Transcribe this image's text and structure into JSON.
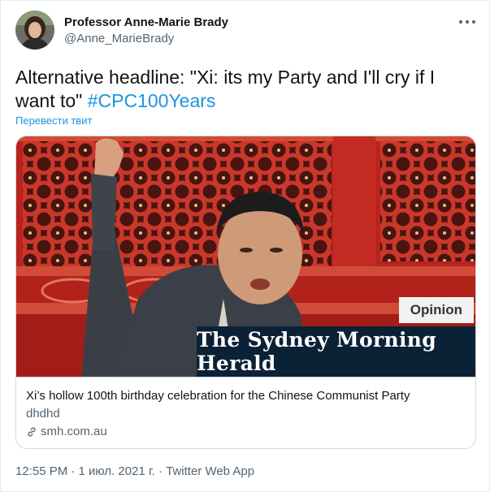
{
  "author": {
    "name": "Professor Anne-Marie Brady",
    "handle": "@Anne_MarieBrady"
  },
  "tweet": {
    "text": "Alternative headline: \"Xi: its my Party and I'll cry if I want to\" ",
    "hashtag": "#CPC100Years",
    "translate_label": "Перевести твит"
  },
  "card": {
    "badge": "Opinion",
    "publication": "The Sydney Morning Herald",
    "title": "Xi’s hollow 100th birthday celebration for the Chinese Communist Party",
    "description": "dhdhd",
    "domain": "smh.com.au"
  },
  "meta": {
    "timestamp": "12:55 PM · 1 июл. 2021 г. · Twitter Web App"
  },
  "colors": {
    "link": "#1b95e0",
    "secondary_text": "#536471",
    "primary_text": "#0f1419",
    "border": "#cfd9de",
    "masthead_bg": "#0b2136",
    "gate_red": "#b8241d"
  },
  "icons": {
    "more": "more-icon",
    "link": "link-icon"
  }
}
